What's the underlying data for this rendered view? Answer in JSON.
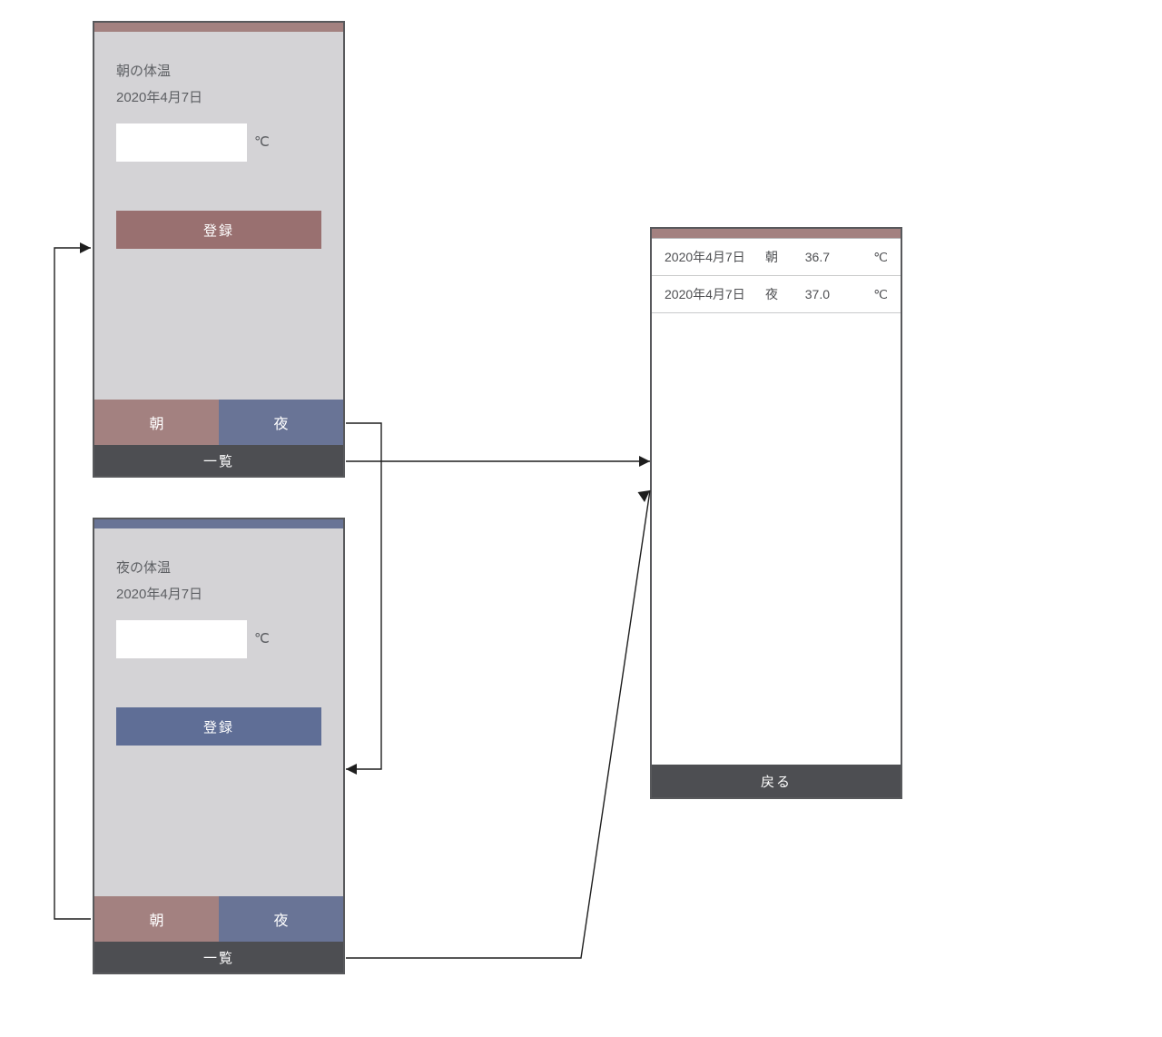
{
  "colors": {
    "morning": "#a38180",
    "night": "#697496",
    "dark": "#4d4e52",
    "panel": "#d4d3d6"
  },
  "morningScreen": {
    "title": "朝の体温",
    "date": "2020年4月7日",
    "unit": "℃",
    "register": "登録",
    "tabs": {
      "morning": "朝",
      "night": "夜"
    },
    "listBar": "一覧"
  },
  "nightScreen": {
    "title": "夜の体温",
    "date": "2020年4月7日",
    "unit": "℃",
    "register": "登録",
    "tabs": {
      "morning": "朝",
      "night": "夜"
    },
    "listBar": "一覧"
  },
  "listScreen": {
    "rows": [
      {
        "date": "2020年4月7日",
        "time": "朝",
        "value": "36.7",
        "unit": "℃"
      },
      {
        "date": "2020年4月7日",
        "time": "夜",
        "value": "37.0",
        "unit": "℃"
      }
    ],
    "back": "戻る"
  }
}
